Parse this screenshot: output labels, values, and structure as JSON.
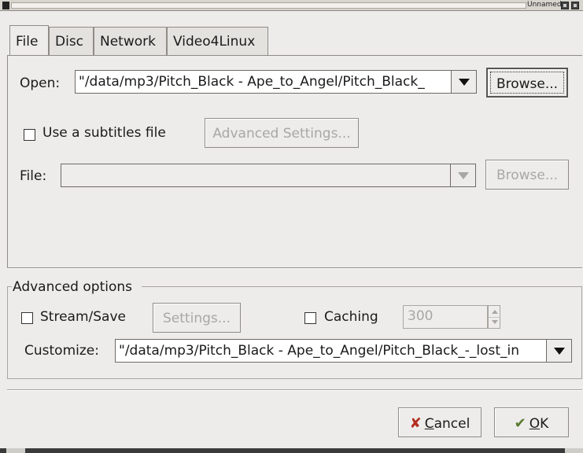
{
  "window": {
    "title": "Unnamed"
  },
  "tabs": [
    "File",
    "Disc",
    "Network",
    "Video4Linux"
  ],
  "file_tab": {
    "open_label": "Open:",
    "open_value": "\"/data/mp3/Pitch_Black - Ape_to_Angel/Pitch_Black_",
    "browse_label": "Browse...",
    "subtitles_label": "Use a subtitles file",
    "subtitles_checked": false,
    "advanced_settings_label": "Advanced Settings...",
    "file_label": "File:",
    "file_value": "",
    "file_browse_label": "Browse..."
  },
  "advanced": {
    "title": "Advanced options",
    "stream_save_label": "Stream/Save",
    "stream_save_checked": false,
    "settings_label": "Settings...",
    "caching_label": "Caching",
    "caching_checked": false,
    "caching_value": "300",
    "customize_label": "Customize:",
    "customize_value": "\"/data/mp3/Pitch_Black - Ape_to_Angel/Pitch_Black_-_lost_in"
  },
  "footer": {
    "cancel_prefix": "",
    "cancel_underline": "C",
    "cancel_rest": "ancel",
    "ok_underline": "O",
    "ok_rest": "K"
  }
}
